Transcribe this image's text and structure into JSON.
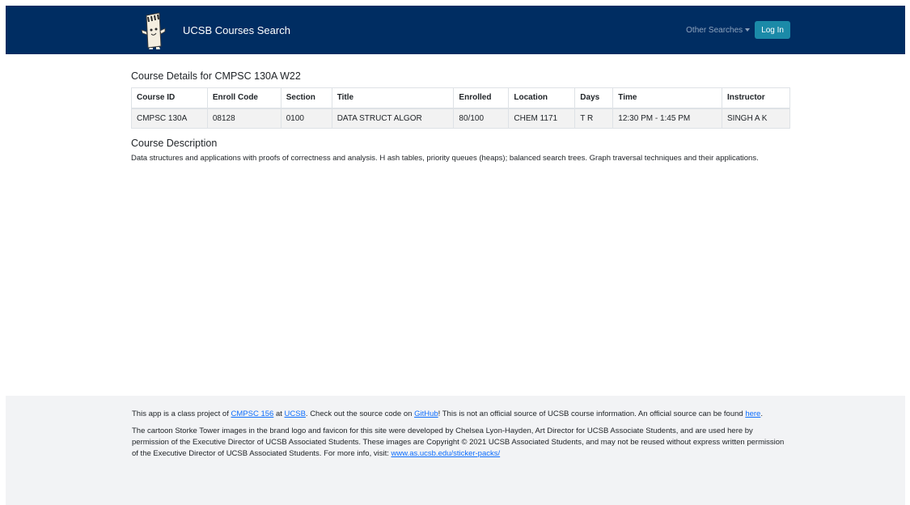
{
  "navbar": {
    "brand_text": "UCSB Courses Search",
    "other_searches_label": "Other Searches",
    "login_label": "Log In",
    "bg_color": "#002d62",
    "login_color": "#1b8aa8"
  },
  "course": {
    "heading": "Course Details for CMPSC 130A W22",
    "columns": [
      "Course ID",
      "Enroll Code",
      "Section",
      "Title",
      "Enrolled",
      "Location",
      "Days",
      "Time",
      "Instructor"
    ],
    "row": [
      "CMPSC 130A",
      "08128",
      "0100",
      "DATA STRUCT ALGOR",
      "80/100",
      "CHEM 1171",
      "T R",
      "12:30 PM - 1:45 PM",
      "SINGH A K"
    ],
    "description_heading": "Course Description",
    "description": "Data structures and applications with proofs of correctness and analysis. H ash tables, priority queues (heaps); balanced search trees. Graph traversal techniques and their applications."
  },
  "footer": {
    "p1_prefix": "This app is a class project of ",
    "p1_link_course": "CMPSC 156",
    "p1_at": " at ",
    "p1_link_ucsb": "UCSB",
    "p1_mid": ". Check out the source code on ",
    "p1_link_github": "GitHub",
    "p1_suffix": "! This is not an official source of UCSB course information. An official source can be found ",
    "p1_link_here": "here",
    "p1_end": ".",
    "p2_text": "The cartoon Storke Tower images in the brand logo and favicon for this site were developed by Chelsea Lyon-Hayden, Art Director for UCSB Associate Students, and are used here by permission of the Executive Director of UCSB Associated Students. These images are Copyright © 2021 UCSB Associated Students, and may not be reused without express written permission of the Executive Director of UCSB Associated Students. For more info, visit: ",
    "p2_link": "www.as.ucsb.edu/sticker-packs/",
    "link_color": "#0d6efd"
  }
}
